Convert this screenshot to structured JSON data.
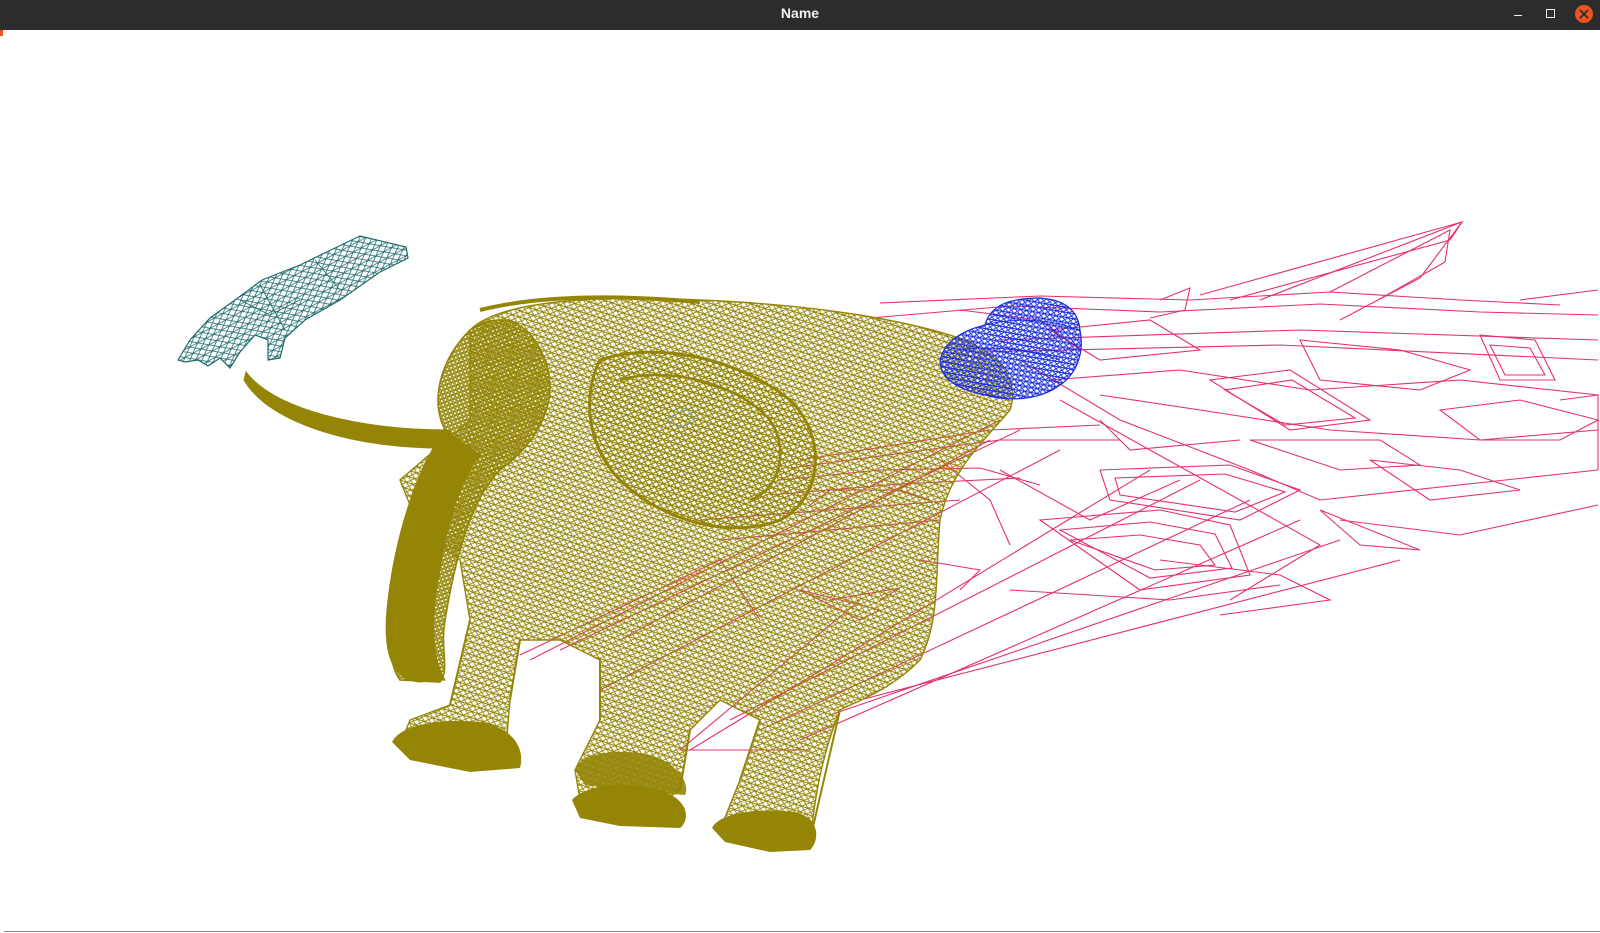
{
  "window": {
    "title": "Name",
    "controls": {
      "minimize": "minimize-icon",
      "maximize": "maximize-icon",
      "close": "close-icon"
    }
  },
  "scene": {
    "meshes": [
      {
        "name": "hand",
        "color": "#1f6b6b"
      },
      {
        "name": "elephant",
        "color": "#948507"
      },
      {
        "name": "cap",
        "color": "#1a2fe0"
      },
      {
        "name": "building",
        "color": "#e8306b"
      }
    ]
  }
}
